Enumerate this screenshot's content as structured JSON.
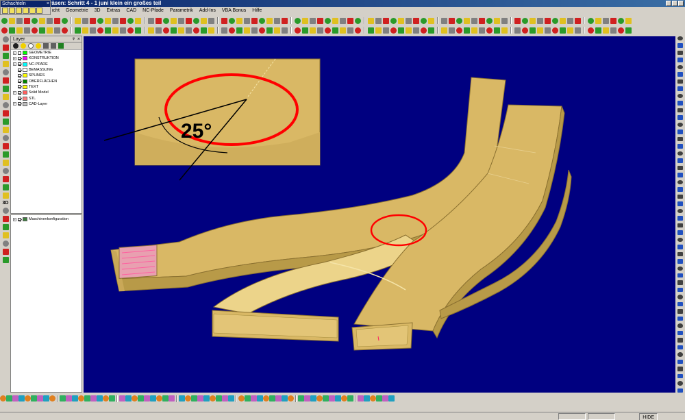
{
  "window": {
    "title": "erfräsen: Schritt 4 - 1 juni klein ein großes teil"
  },
  "palette": {
    "title": "Schachteln",
    "close_glyph": "×"
  },
  "menu": [
    "icht",
    "Geometrie",
    "3D",
    "Extras",
    "CAD",
    "NC-Pfade",
    "Parametrik",
    "Add-Ins",
    "VBA Bonus",
    "Hilfe"
  ],
  "layer_panel": {
    "title": "Layer",
    "pin_glyph": "ᵠ",
    "close_glyph": "×",
    "layers": [
      {
        "name": "GEOMETRIE",
        "color": "#00ff00",
        "checked": false,
        "expandable": true
      },
      {
        "name": "KONSTRUKTION",
        "color": "#ff00ff",
        "checked": true,
        "expandable": true
      },
      {
        "name": "NC-PFADE",
        "color": "#00ffff",
        "checked": true,
        "expandable": true
      },
      {
        "name": "BEMASSUNG",
        "color": "#ffffff",
        "checked": true,
        "expandable": false
      },
      {
        "name": "SPLINES",
        "color": "#ffff00",
        "checked": true,
        "expandable": false
      },
      {
        "name": "OBERFLÄCHEN",
        "color": "#008000",
        "checked": true,
        "expandable": false
      },
      {
        "name": "TEXT",
        "color": "#ffff00",
        "checked": true,
        "expandable": false
      },
      {
        "name": "Solid Model",
        "color": "#ff6060",
        "checked": true,
        "expandable": true
      },
      {
        "name": "STL",
        "color": "#ff8080",
        "checked": true,
        "expandable": false
      },
      {
        "name": "CAD-Layer",
        "color": "#c0c0c0",
        "checked": true,
        "expandable": true
      }
    ]
  },
  "machine_panel": {
    "item": "Maschinenkonfiguration",
    "checked": true
  },
  "viewport": {
    "background": "#000080",
    "part_color": "#d9b865",
    "part_shadow": "#b89a48",
    "part_highlight": "#ecd48a",
    "mark_color": "#ff0000"
  },
  "detail_view": {
    "angle_label": "25°"
  },
  "left_toolbar": {
    "label_3d": "3D"
  },
  "status": {
    "hide_label": "HIDE"
  }
}
